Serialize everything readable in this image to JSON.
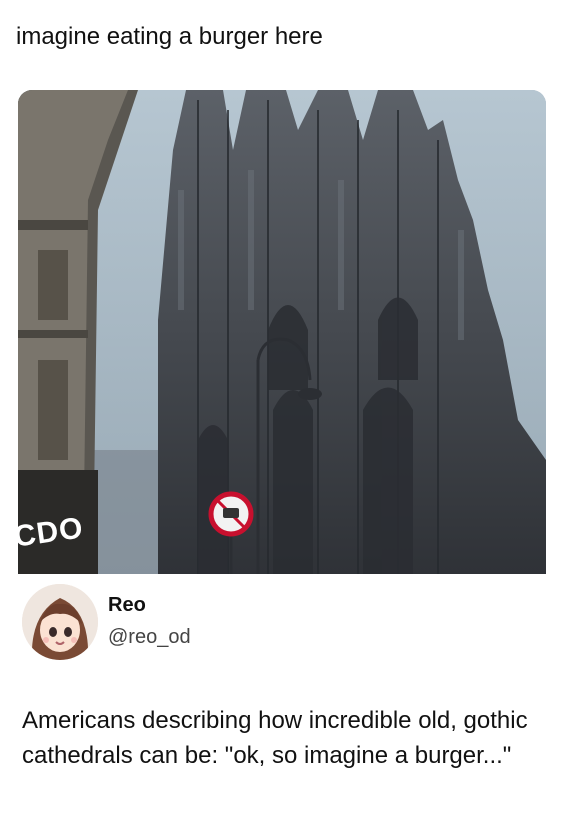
{
  "caption": "imagine eating a burger here",
  "photo": {
    "icon": "cathedral-photo",
    "storefront_text": "CDO"
  },
  "author": {
    "name": "Reo",
    "handle": "@reo_od",
    "avatar_icon": "anime-avatar-icon"
  },
  "post": {
    "text": "Americans describing how incredible old, gothic cathedrals can be: \"ok, so imagine a burger...\""
  },
  "colors": {
    "sky": "#a9bac6",
    "stone": "#3a3d42",
    "sign_red": "#c8102e"
  }
}
